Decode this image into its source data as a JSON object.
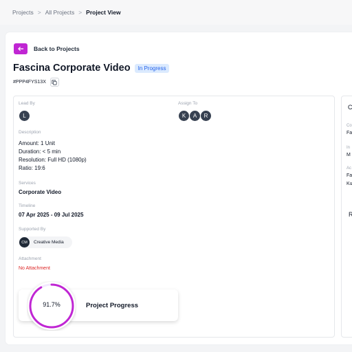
{
  "breadcrumb": {
    "items": [
      "Projects",
      "All Projects"
    ],
    "separator": ">",
    "current": "Project View"
  },
  "back": {
    "icon": "arrow-left-icon",
    "label": "Back to Projects"
  },
  "project": {
    "title": "Fascina Corporate Video",
    "status": "In Progress",
    "code": "#PPP4FYS13X"
  },
  "details": {
    "lead_by_label": "Lead By",
    "lead_initial": "L",
    "assign_to_label": "Assign To",
    "assignees": [
      "K",
      "A",
      "R"
    ],
    "description_label": "Description",
    "description_lines": [
      "Amount: 1 Unit",
      "Duration: < 5 min",
      "Resolution: Full HD (1080p)",
      "Ratio: 19:6"
    ],
    "services_label": "Services",
    "services_value": "Corporate Video",
    "timeline_label": "Timeline",
    "timeline_value": "07 Apr 2025 - 09 Jul 2025",
    "supported_by_label": "Supported By",
    "supporter_initials": "CM",
    "supporter_name": "Creative Media",
    "attachment_label": "Attachment",
    "attachment_value": "No Attachment"
  },
  "progress": {
    "percent_text": "91.7%",
    "percent": 91.7,
    "label": "Project Progress"
  },
  "right_panel": {
    "header_letter": "C",
    "small_labels": [
      "Co",
      "In",
      "Ac"
    ],
    "values": [
      "Fa",
      "M",
      "Fa",
      "Ku"
    ],
    "section_letter": "R"
  },
  "colors": {
    "accent": "#c026d3",
    "badge_bg": "#dbeafe",
    "badge_text": "#2563eb",
    "danger": "#dc2626"
  }
}
